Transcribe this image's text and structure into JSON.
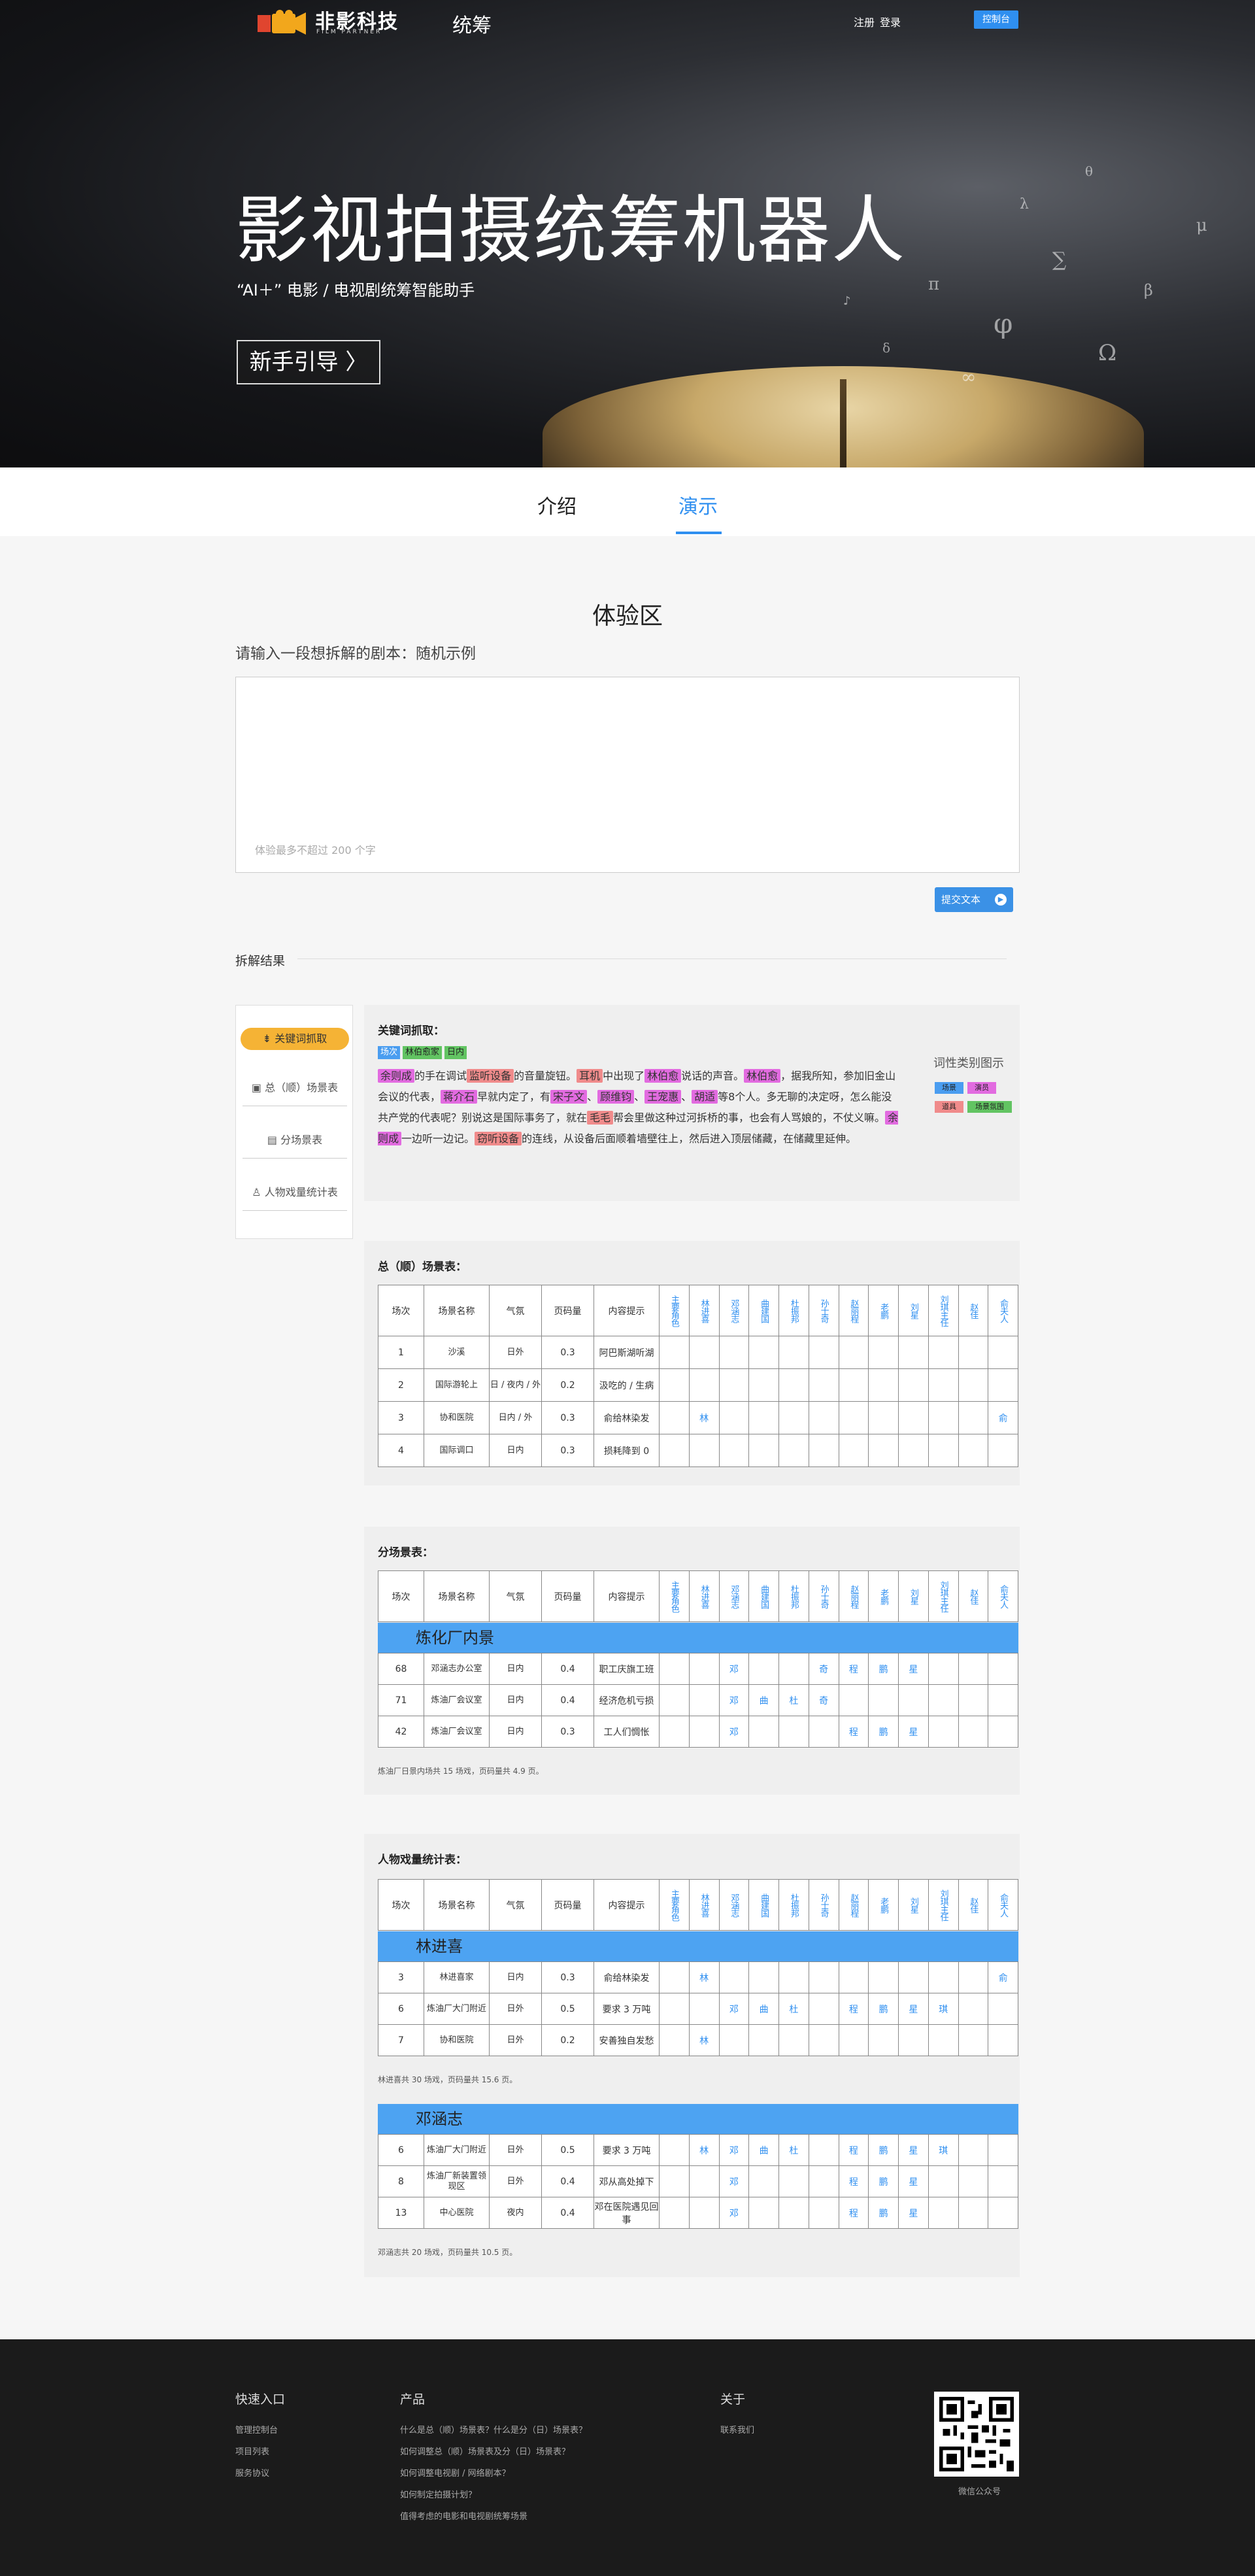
{
  "header": {
    "brand": "非影科技",
    "brand_en": "FILM PARTNER",
    "title": "统筹",
    "register": "注册",
    "login": "登录",
    "console": "控制台"
  },
  "hero": {
    "title": "影视拍摄统筹机器人",
    "subtitle": "“AI＋” 电影 / 电视剧统筹智能助手",
    "guide_button": "新手引导 〉"
  },
  "tabs": [
    {
      "label": "介绍"
    },
    {
      "label": "演示"
    }
  ],
  "demo": {
    "section_title": "体验区",
    "prompt": "请输入一段想拆解的剧本：随机示例",
    "placeholder": "体验最多不超过 200 个字",
    "submit": "提交文本",
    "submit_icon": "play-icon",
    "result_label": "拆解结果"
  },
  "side_nav": [
    {
      "label": "关键词抓取"
    },
    {
      "label": "总（顺）场景表"
    },
    {
      "label": "分场景表"
    },
    {
      "label": "人物戏量统计表"
    }
  ],
  "keywords": {
    "title": "关键词抓取：",
    "tags": [
      "场次",
      "林伯愈家",
      "日内"
    ],
    "text": "余则成的手在调试监听设备的音量旋钮。耳机中出现了林伯愈说话的声音。林伯愈，据我所知，参加旧金山会议的代表，蒋介石早就内定了，有宋子文、顾维钧、王宠惠、胡适等8个人。多无聊的决定呀，怎么能没共产党的代表呢？别说这是国际事务了，就在毛毛帮会里做这种过河拆桥的事，也会有人骂娘的，不仗义嘛。余则成一边听一边记。窃听设备的连线，从设备后面顺着墙壁往上，然后进入顶层储藏，在储藏里延伸。",
    "legend_title": "词性类别图示",
    "legend": [
      {
        "label": "场景",
        "color": "#4a9df0"
      },
      {
        "label": "演员",
        "color": "#e26be0"
      },
      {
        "label": "道具",
        "color": "#f08b8b"
      },
      {
        "label": "场景氛围",
        "color": "#62c462"
      }
    ]
  },
  "columns": {
    "fixed": [
      "场次",
      "场景名称",
      "气氛",
      "页码量",
      "内容提示"
    ],
    "roles": [
      "主要角色",
      "林进喜",
      "邓涵志",
      "曲建国",
      "杜振邦",
      "孙士奇",
      "赵丽程",
      "老鹏",
      "刘星",
      "刘琪主任",
      "赵佳",
      "俞夫人"
    ]
  },
  "table1": {
    "title": "总（顺）场景表：",
    "rows": [
      {
        "no": "1",
        "scene": "沙溪",
        "mood": "日外",
        "pages": "0.3",
        "hint": "阿巴斯湖听湖",
        "marks": [
          "",
          "",
          "",
          "",
          "",
          "",
          "",
          "",
          "",
          "",
          "",
          ""
        ]
      },
      {
        "no": "2",
        "scene": "国际游轮上",
        "mood": "日 / 夜内 / 外",
        "pages": "0.2",
        "hint": "汲吃的 / 生病",
        "marks": [
          "",
          "",
          "",
          "",
          "",
          "",
          "",
          "",
          "",
          "",
          "",
          ""
        ]
      },
      {
        "no": "3",
        "scene": "协和医院",
        "mood": "日内 / 外",
        "pages": "0.3",
        "hint": "俞给林染发",
        "marks": [
          "",
          "林",
          "",
          "",
          "",
          "",
          "",
          "",
          "",
          "",
          "",
          "俞"
        ]
      },
      {
        "no": "4",
        "scene": "国际调口",
        "mood": "日内",
        "pages": "0.3",
        "hint": "损耗降到 0",
        "marks": [
          "",
          "",
          "",
          "",
          "",
          "",
          "",
          "",
          "",
          "",
          "",
          ""
        ]
      }
    ]
  },
  "table2": {
    "title": "分场景表：",
    "group": "炼化厂内景",
    "rows": [
      {
        "no": "68",
        "scene": "邓涵志办公室",
        "mood": "日内",
        "pages": "0.4",
        "hint": "职工庆旗工班",
        "marks": [
          "",
          "",
          "邓",
          "",
          "",
          "奇",
          "程",
          "鹏",
          "星",
          "",
          "",
          ""
        ]
      },
      {
        "no": "71",
        "scene": "炼油厂会议室",
        "mood": "日内",
        "pages": "0.4",
        "hint": "经济危机亏损",
        "marks": [
          "",
          "",
          "邓",
          "曲",
          "杜",
          "奇",
          "",
          "",
          "",
          "",
          "",
          ""
        ]
      },
      {
        "no": "42",
        "scene": "炼油厂会议室",
        "mood": "日内",
        "pages": "0.3",
        "hint": "工人们惆怅",
        "marks": [
          "",
          "",
          "邓",
          "",
          "",
          "",
          "程",
          "鹏",
          "星",
          "",
          "",
          ""
        ]
      }
    ],
    "note": "炼油厂日景内场共 15 场戏，页码量共 4.9 页。"
  },
  "table3": {
    "title": "人物戏量统计表：",
    "groups": [
      {
        "name": "林进喜",
        "rows": [
          {
            "no": "3",
            "scene": "林进喜家",
            "mood": "日内",
            "pages": "0.3",
            "hint": "俞给林染发",
            "marks": [
              "",
              "林",
              "",
              "",
              "",
              "",
              "",
              "",
              "",
              "",
              "",
              "俞"
            ]
          },
          {
            "no": "6",
            "scene": "炼油厂大门附近",
            "mood": "日外",
            "pages": "0.5",
            "hint": "要求 3 万吨",
            "marks": [
              "",
              "",
              "邓",
              "曲",
              "杜",
              "",
              "程",
              "鹏",
              "星",
              "琪",
              "",
              ""
            ]
          },
          {
            "no": "7",
            "scene": "协和医院",
            "mood": "日外",
            "pages": "0.2",
            "hint": "安善独自发愁",
            "marks": [
              "",
              "林",
              "",
              "",
              "",
              "",
              "",
              "",
              "",
              "",
              "",
              ""
            ]
          }
        ],
        "note": "林进喜共 30 场戏，页码量共 15.6 页。"
      },
      {
        "name": "邓涵志",
        "rows": [
          {
            "no": "6",
            "scene": "炼油厂大门附近",
            "mood": "日外",
            "pages": "0.5",
            "hint": "要求 3 万吨",
            "marks": [
              "",
              "林",
              "邓",
              "曲",
              "杜",
              "",
              "程",
              "鹏",
              "星",
              "琪",
              "",
              ""
            ]
          },
          {
            "no": "8",
            "scene": "炼油厂新装置领现区",
            "mood": "日外",
            "pages": "0.4",
            "hint": "邓从高处掉下",
            "marks": [
              "",
              "",
              "邓",
              "",
              "",
              "",
              "程",
              "鹏",
              "星",
              "",
              "",
              ""
            ]
          },
          {
            "no": "13",
            "scene": "中心医院",
            "mood": "夜内",
            "pages": "0.4",
            "hint": "邓在医院遇见回事",
            "marks": [
              "",
              "",
              "邓",
              "",
              "",
              "",
              "程",
              "鹏",
              "星",
              "",
              "",
              ""
            ]
          }
        ],
        "note": "邓涵志共 20 场戏，页码量共 10.5 页。"
      }
    ]
  },
  "footer": {
    "col1": {
      "title": "快速入口",
      "links": [
        "管理控制台",
        "项目列表",
        "服务协议"
      ]
    },
    "col2": {
      "title": "产品",
      "links": [
        "什么是总（顺）场景表？什么是分（日）场景表？",
        "如何调整总（顺）场景表及分（日）场景表？",
        "如何调整电视剧 / 网络剧本？",
        "如何制定拍摄计划？",
        "值得考虑的电影和电视剧统筹场景"
      ]
    },
    "col3": {
      "title": "关于",
      "links": [
        "联系我们"
      ]
    },
    "qr_label": "微信公众号"
  }
}
